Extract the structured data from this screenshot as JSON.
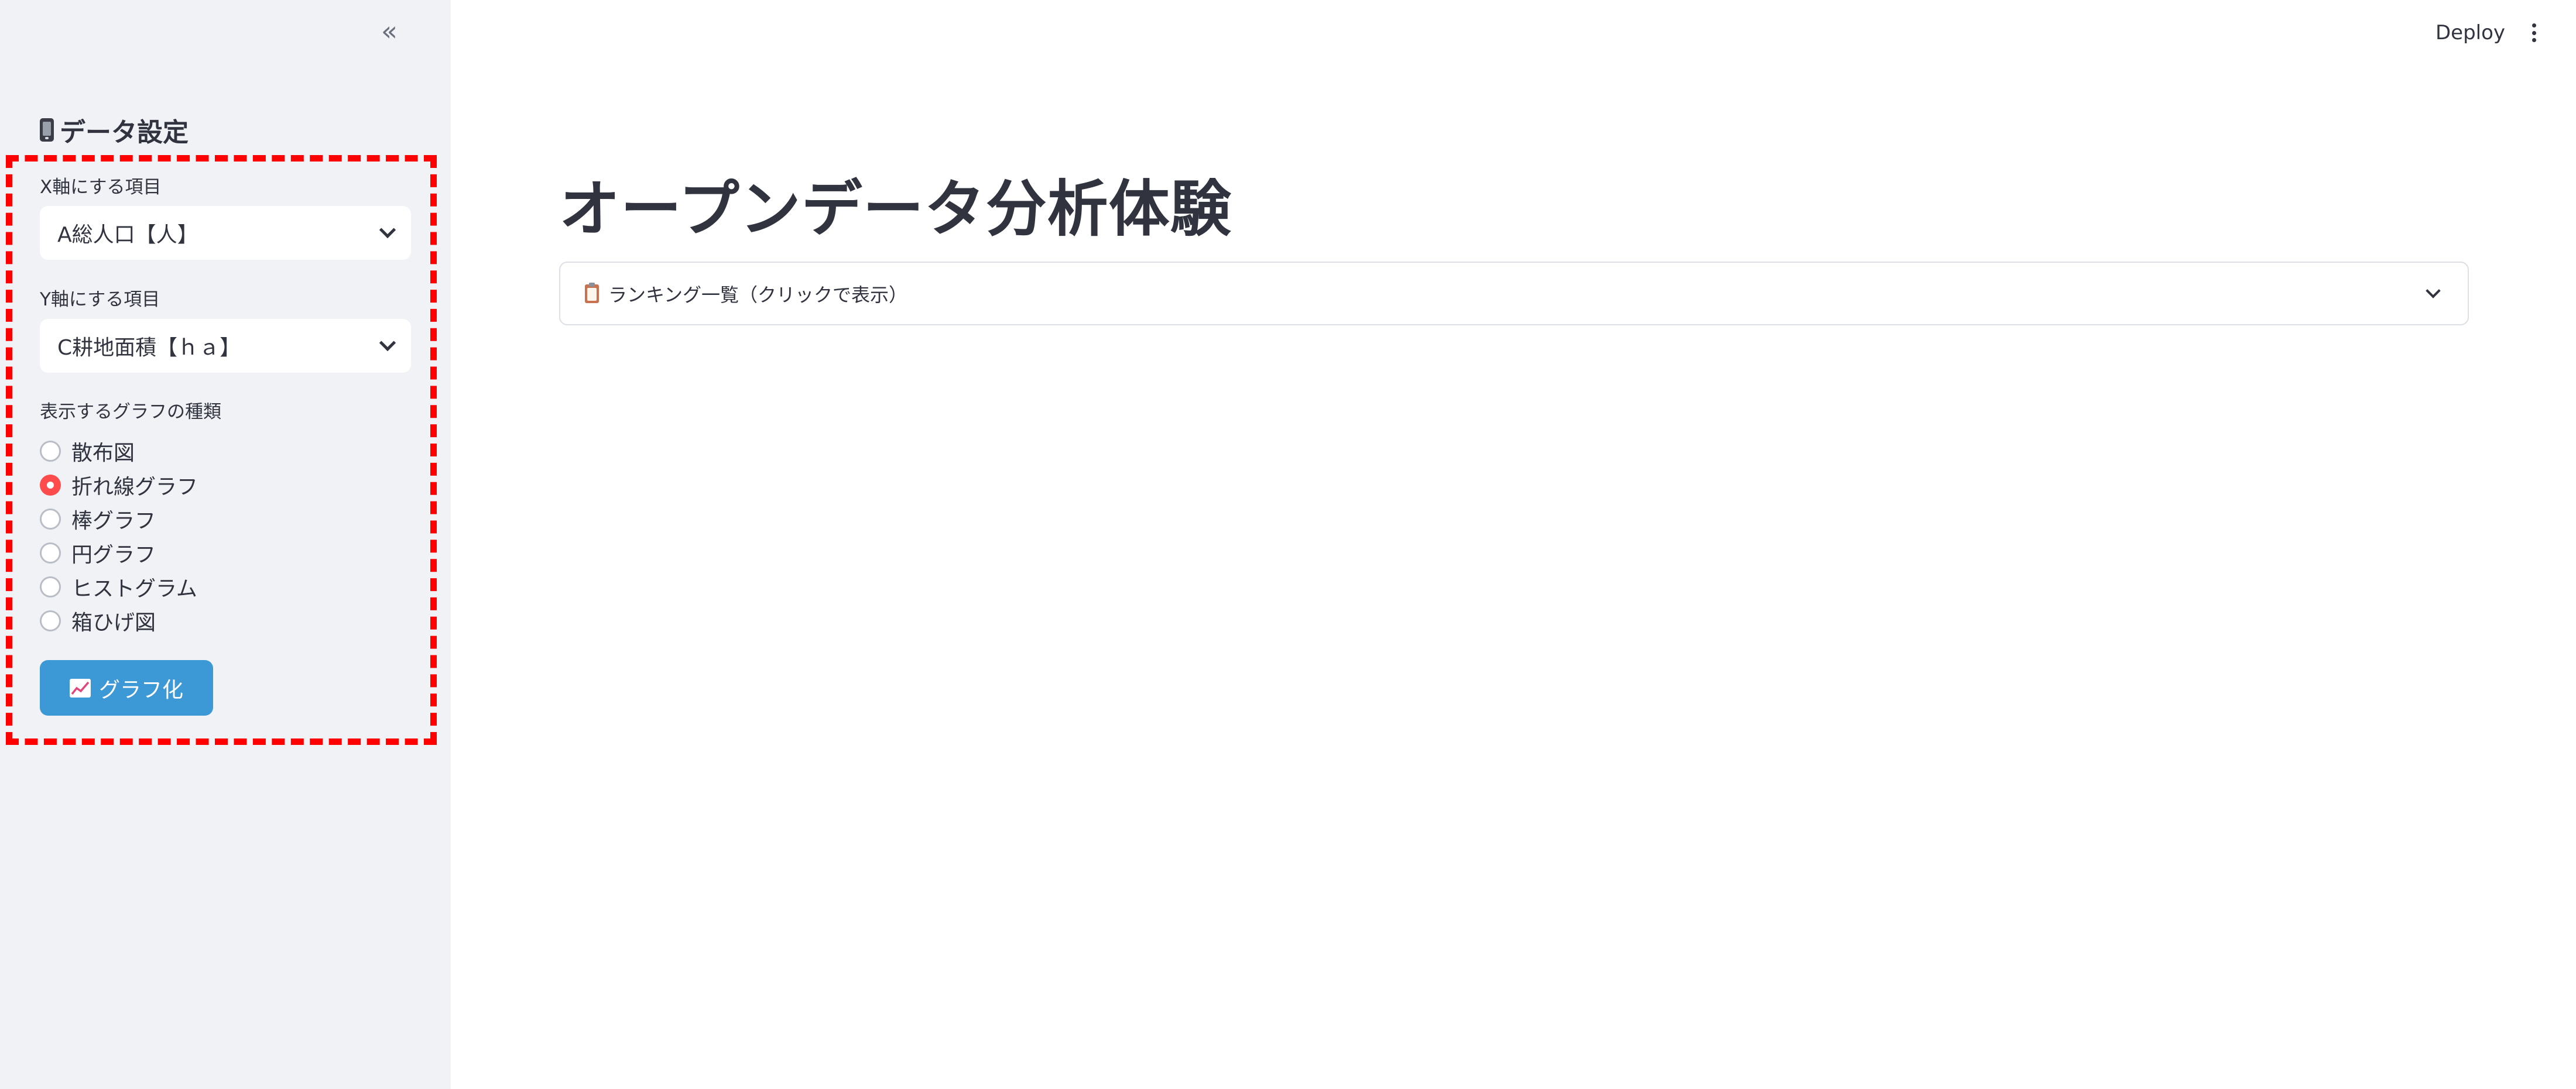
{
  "sidebar": {
    "collapse_label": "«",
    "title": "データ設定",
    "title_icon": "mobile-phone-icon",
    "x_axis": {
      "label": "X軸にする項目",
      "value": "A総人口【人】"
    },
    "y_axis": {
      "label": "Y軸にする項目",
      "value": "C耕地面積【ｈａ】"
    },
    "chart_type": {
      "label": "表示するグラフの種類",
      "options": [
        "散布図",
        "折れ線グラフ",
        "棒グラフ",
        "円グラフ",
        "ヒストグラム",
        "箱ひげ図"
      ],
      "selected": "折れ線グラフ"
    },
    "submit_button": {
      "label": "グラフ化",
      "icon": "chart-increasing-icon"
    }
  },
  "header": {
    "deploy_label": "Deploy",
    "menu_icon": "kebab-menu-icon"
  },
  "main": {
    "title": "オープンデータ分析体験",
    "expander": {
      "label": "ランキング一覧（クリックで表示）",
      "icon": "clipboard-icon"
    }
  },
  "colors": {
    "sidebar_bg": "#f0f2f6",
    "accent_radio": "#ff4b4b",
    "button_bg": "#3d98d6",
    "highlight_border": "#ff0000",
    "text": "#31333f"
  }
}
